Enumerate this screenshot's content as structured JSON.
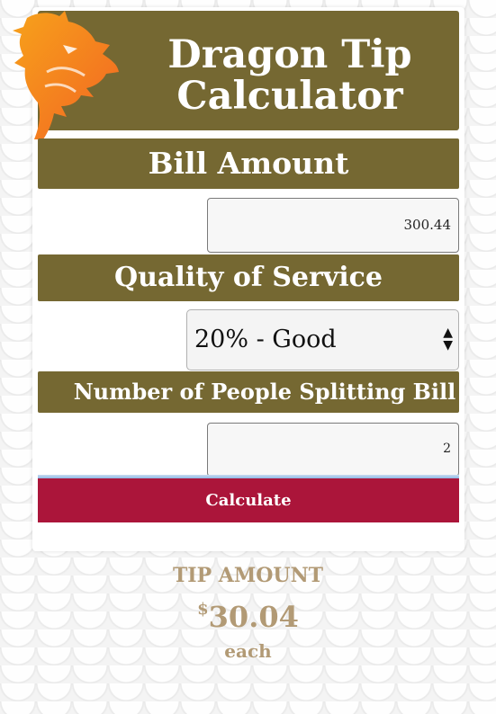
{
  "header": {
    "title_line1": "Dragon Tip",
    "title_line2": "Calculator",
    "logo_icon": "dragon-icon"
  },
  "bill": {
    "label": "Bill Amount",
    "value": "300.44"
  },
  "service": {
    "label": "Quality of Service",
    "selected": "20% - Good"
  },
  "people": {
    "label": "Number of People Splitting Bill",
    "value": "2"
  },
  "actions": {
    "calculate_label": "Calculate"
  },
  "result": {
    "label": "TIP AMOUNT",
    "currency": "$",
    "amount": "30.04",
    "suffix": "each"
  },
  "colors": {
    "brand_olive": "#756832",
    "button_red": "#ab153a",
    "result_tan": "#b29a75",
    "dragon_orange": "#f58220"
  }
}
